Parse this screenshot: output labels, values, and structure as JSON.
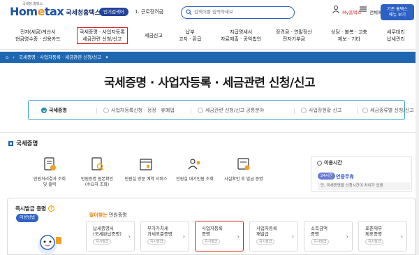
{
  "header": {
    "logo_sub": "국세청 홈택스",
    "logo_main_a": "Hom",
    "logo_main_b": "e",
    "logo_main_c": "tax",
    "logo_kr": "국세청홈택스",
    "popular_badge": "인기검색어",
    "popular_text": "1. 근로장려금",
    "search_placeholder": "검색어를 입력하세요",
    "my_label": "My홈택스",
    "menu_label": "전체메뉴",
    "old_btn_line1": "기존 홈택스",
    "old_btn_line2": "메뉴 보기"
  },
  "gnb": [
    {
      "line1": "전자(세금)계산서",
      "line2": "현금영수증 · 신용카드"
    },
    {
      "line1": "국세증명 · 사업자등록",
      "line2": "세금관련 신청/신고"
    },
    {
      "line1": "세금신고",
      "line2": ""
    },
    {
      "line1": "납부",
      "line2": "고지 · 환급"
    },
    {
      "line1": "지급명세서",
      "line2": "자료제출 · 공익법인"
    },
    {
      "line1": "장려금 · 연말정산",
      "line2": "전자기부금"
    },
    {
      "line1": "상담 · 불복 · 고충",
      "line2": "제보 · 기타"
    },
    {
      "line1": "세무대리",
      "line2": "납세관리"
    }
  ],
  "breadcrumb": [
    "국세증명 · 사업자등록 · 세금관련 신청/신고"
  ],
  "page_title": "국세증명 · 사업자등록 · 세금관련 신청/신고",
  "tabs": [
    "국세증명",
    "사업자등록신청 · 정정 · 휴폐업",
    "세금관련 신청/신고 공통분야",
    "사업장현황 신고",
    "세금종류별 신청/신고"
  ],
  "section_title": "국세증명",
  "services": [
    {
      "line1": "민원처리결과 조회",
      "line2": "및 출력"
    },
    {
      "line1": "민원증명 원본확인",
      "line2": "(수요처 조회)"
    },
    {
      "line1": "민원실 방문 예약 서비스",
      "line2": ""
    },
    {
      "line1": "민원실 대기인원 조회",
      "line2": ""
    },
    {
      "line1": "사실확인 후 발급 증명",
      "line2": ""
    }
  ],
  "notice": {
    "title": "이용시간",
    "badge": "24시간",
    "label": "연중무휴",
    "desc": "단, 국세증명을 신청시간이 차이가 있음"
  },
  "issue": {
    "title": "즉시발급 증명",
    "guide_btn": "이용방법",
    "freq_hl": "많이찾는",
    "freq_rest": " 민원증명",
    "cards": [
      {
        "line1": "납세증명서",
        "line2": "(국세완납증명)",
        "tag": "즉시발급"
      },
      {
        "line1": "부가가치세",
        "line2": "과세표준증명",
        "tag": "즉시발급"
      },
      {
        "line1": "사업자등록",
        "line2": "증명",
        "tag": "즉시발급"
      },
      {
        "line1": "사업자등록",
        "line2": "재발급",
        "tag": "즉시발급"
      },
      {
        "line1": "소득금액",
        "line2": "증명",
        "tag": "즉시발급"
      },
      {
        "line1": "표준재무",
        "line2": "제표증명",
        "tag": "즉시발급"
      }
    ]
  }
}
